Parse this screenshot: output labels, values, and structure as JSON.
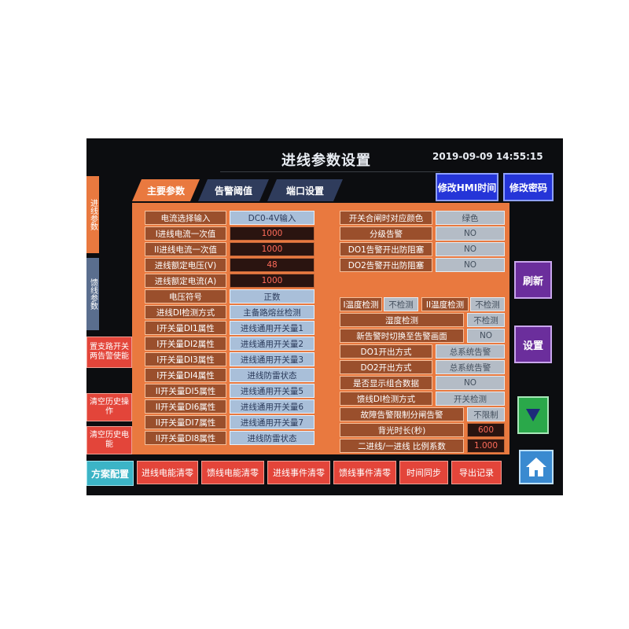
{
  "header": {
    "title": "进线参数设置",
    "datetime": "2019-09-09 14:55:15"
  },
  "tabs": [
    {
      "label": "主要参数",
      "active": true
    },
    {
      "label": "告警阈值",
      "active": false
    },
    {
      "label": "端口设置",
      "active": false
    }
  ],
  "top_buttons": {
    "hmi_time": "修改HMI时间",
    "password": "修改密码"
  },
  "side_tabs": [
    "进线参数",
    "馈线参数"
  ],
  "side_buttons": {
    "alarm_linkage": "置支路开关两告警使能",
    "clear_history_ops": "清空历史操作",
    "clear_history_energy": "清空历史电能",
    "plan_config": "方案配置"
  },
  "right_buttons": {
    "refresh": "刷新",
    "settings": "设置"
  },
  "left_params": [
    {
      "label": "电流选择输入",
      "value": "DC0-4V输入",
      "kind": "select"
    },
    {
      "label": "I进线电流一次值",
      "value": "1000",
      "kind": "num"
    },
    {
      "label": "II进线电流一次值",
      "value": "1000",
      "kind": "num"
    },
    {
      "label": "进线额定电压(V)",
      "value": "48",
      "kind": "num"
    },
    {
      "label": "进线额定电流(A)",
      "value": "1000",
      "kind": "num"
    },
    {
      "label": "电压符号",
      "value": "正数",
      "kind": "select"
    },
    {
      "label": "进线DI检测方式",
      "value": "主备路熔丝检测",
      "kind": "select"
    },
    {
      "label": "I开关量DI1属性",
      "value": "进线通用开关量1",
      "kind": "select"
    },
    {
      "label": "I开关量DI2属性",
      "value": "进线通用开关量2",
      "kind": "select"
    },
    {
      "label": "I开关量DI3属性",
      "value": "进线通用开关量3",
      "kind": "select"
    },
    {
      "label": "I开关量DI4属性",
      "value": "进线防雷状态",
      "kind": "select"
    },
    {
      "label": "II开关量DI5属性",
      "value": "进线通用开关量5",
      "kind": "select"
    },
    {
      "label": "II开关量DI6属性",
      "value": "进线通用开关量6",
      "kind": "select"
    },
    {
      "label": "II开关量DI7属性",
      "value": "进线通用开关量7",
      "kind": "select"
    },
    {
      "label": "II开关量DI8属性",
      "value": "进线防雷状态",
      "kind": "select"
    }
  ],
  "right_params_top": [
    {
      "label": "开关合闸时对应颜色",
      "value": "绿色"
    },
    {
      "label": "分级告警",
      "value": "NO"
    },
    {
      "label": "DO1告警开出防阻塞",
      "value": "NO"
    },
    {
      "label": "DO2告警开出防阻塞",
      "value": "NO"
    }
  ],
  "temp_row": {
    "t1_label": "I温度检测",
    "t1_value": "不检测",
    "t2_label": "II温度检测",
    "t2_value": "不检测"
  },
  "right_params_bottom": [
    {
      "label": "湿度检测",
      "value": "不检测",
      "kind": "gray"
    },
    {
      "label": "新告警时切换至告警画面",
      "value": "NO",
      "kind": "gray"
    },
    {
      "label": "DO1开出方式",
      "value": "总系统告警",
      "kind": "gray"
    },
    {
      "label": "DO2开出方式",
      "value": "总系统告警",
      "kind": "gray"
    },
    {
      "label": "是否显示组合数据",
      "value": "NO",
      "kind": "gray"
    },
    {
      "label": "馈线DI检测方式",
      "value": "开关检测",
      "kind": "gray"
    },
    {
      "label": "故障告警限制分闸告警",
      "value": "不限制",
      "kind": "gray"
    },
    {
      "label": "背光时长(秒)",
      "value": "600",
      "kind": "num"
    },
    {
      "label": "二进线/一进线 比例系数",
      "value": "1.000",
      "kind": "num"
    }
  ],
  "bottom_buttons": [
    "进线电能清零",
    "馈线电能清零",
    "进线事件清零",
    "馈线事件清零",
    "时间同步",
    "导出记录"
  ],
  "colors": {
    "background": "#0c0d10",
    "panel": "#e9793f",
    "label": "#9a4f2c",
    "accent_blue": "#2535d8",
    "alarm_red": "#e3453a"
  }
}
